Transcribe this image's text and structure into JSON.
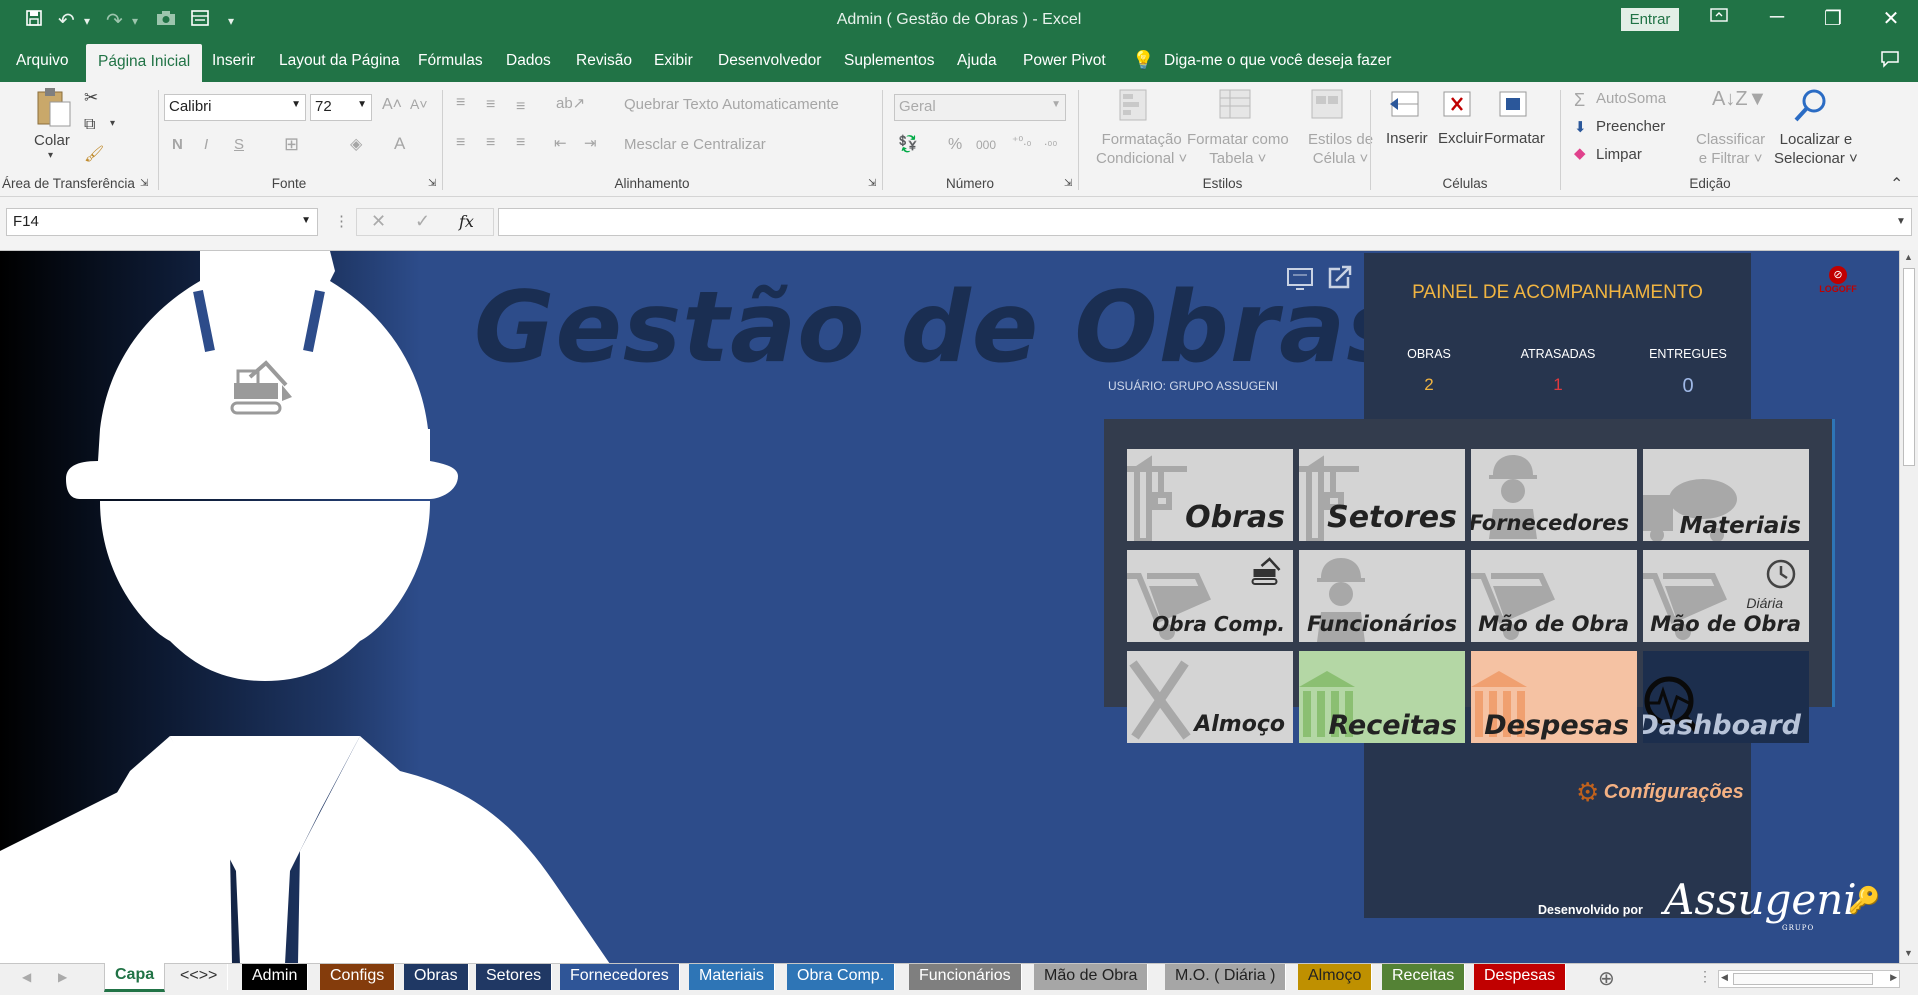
{
  "window": {
    "title": "Admin ( Gestão de Obras )  -  Excel",
    "signin_label": "Entrar"
  },
  "menu": {
    "items": [
      "Arquivo",
      "Página Inicial",
      "Inserir",
      "Layout da Página",
      "Fórmulas",
      "Dados",
      "Revisão",
      "Exibir",
      "Desenvolvedor",
      "Suplementos",
      "Ajuda",
      "Power Pivot"
    ],
    "tell_me": "Diga-me o que você deseja fazer"
  },
  "ribbon": {
    "clipboard": {
      "paste": "Colar",
      "group": "Área de Transferência"
    },
    "font": {
      "name": "Calibri",
      "size": "72",
      "bold": "N",
      "italic": "I",
      "underline": "S",
      "group": "Fonte"
    },
    "alignment": {
      "wrap": "Quebrar Texto Automaticamente",
      "merge": "Mesclar e Centralizar",
      "group": "Alinhamento"
    },
    "number": {
      "format": "Geral",
      "percent": "%",
      "thousands": "000",
      "group": "Número"
    },
    "styles": {
      "conditional_1": "Formatação",
      "conditional_2": "Condicional",
      "table_1": "Formatar como",
      "table_2": "Tabela",
      "cell_1": "Estilos de",
      "cell_2": "Célula",
      "group": "Estilos"
    },
    "cells": {
      "insert": "Inserir",
      "delete": "Excluir",
      "format": "Formatar",
      "group": "Células"
    },
    "editing": {
      "autosum": "AutoSoma",
      "fill": "Preencher",
      "clear": "Limpar",
      "sort_1": "Classificar",
      "sort_2": "e Filtrar",
      "find_1": "Localizar e",
      "find_2": "Selecionar",
      "group": "Edição"
    }
  },
  "formula_bar": {
    "name_box": "F14",
    "fx": "fx",
    "content": ""
  },
  "dashboard": {
    "title": "Gestão de Obras",
    "user": "USUÁRIO: GRUPO ASSUGENI",
    "logoff": "LOGOFF",
    "panel_title": "PAINEL DE ACOMPANHAMENTO",
    "stats": [
      {
        "label": "OBRAS",
        "value": "2"
      },
      {
        "label": "ATRASADAS",
        "value": "1"
      },
      {
        "label": "ENTREGUES",
        "value": "0"
      }
    ],
    "tiles": [
      {
        "label": "Obras"
      },
      {
        "label": "Setores"
      },
      {
        "label": "Fornecedores"
      },
      {
        "label": "Materiais"
      },
      {
        "label": "Obra Comp."
      },
      {
        "label": "Funcionários"
      },
      {
        "label": "Mão de Obra"
      },
      {
        "label": "Mão de Obra",
        "sub": "Diária"
      },
      {
        "label": "Almoço"
      },
      {
        "label": "Receitas"
      },
      {
        "label": "Despesas"
      },
      {
        "label": "Dashboard"
      }
    ],
    "config": "Configurações",
    "developed_by": "Desenvolvido por",
    "signature": "Assugeni",
    "signature_sub": "GRUPO"
  },
  "sheet_tabs": [
    {
      "label": "Capa",
      "color": "#ffffff"
    },
    {
      "label": "<<>>",
      "color": "#f0f0f0"
    },
    {
      "label": "Admin",
      "color": "#000000"
    },
    {
      "label": "Configs",
      "color": "#843c0c"
    },
    {
      "label": "Obras",
      "color": "#1f3864"
    },
    {
      "label": "Setores",
      "color": "#203864"
    },
    {
      "label": "Fornecedores",
      "color": "#2f5597"
    },
    {
      "label": "Materiais",
      "color": "#2e75b6"
    },
    {
      "label": "Obra Comp.",
      "color": "#2e75b6"
    },
    {
      "label": "Funcionários",
      "color": "#7f7f7f"
    },
    {
      "label": "Mão de Obra",
      "color": "#a6a6a6"
    },
    {
      "label": "M.O. ( Diária )",
      "color": "#a6a6a6"
    },
    {
      "label": "Almoço",
      "color": "#bf9000"
    },
    {
      "label": "Receitas",
      "color": "#548235"
    },
    {
      "label": "Despesas",
      "color": "#c00000"
    }
  ]
}
